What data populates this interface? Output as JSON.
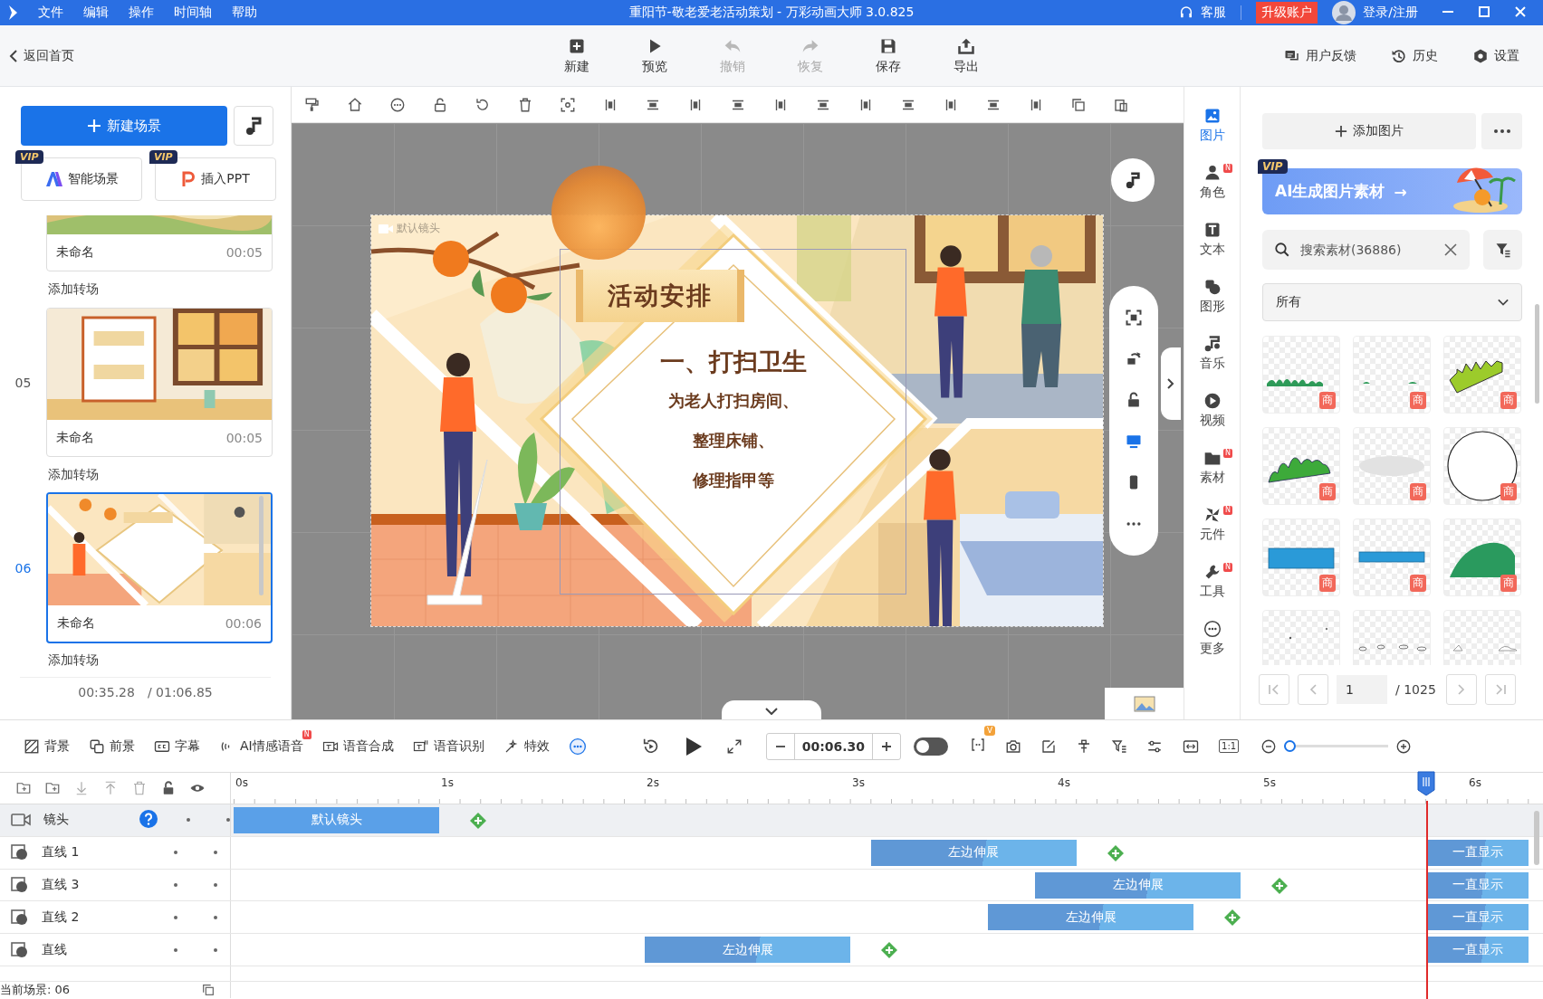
{
  "title_bar": {
    "menu": [
      "文件",
      "编辑",
      "操作",
      "时间轴",
      "帮助"
    ],
    "title": "重阳节-敬老爱老活动策划 - 万彩动画大师 3.0.825",
    "service": "客服",
    "upgrade": "升级账户",
    "login": "登录/注册"
  },
  "toolbar": {
    "back": "返回首页",
    "actions": [
      {
        "label": "新建",
        "kind": "new",
        "disabled": false
      },
      {
        "label": "预览",
        "kind": "preview",
        "disabled": false
      },
      {
        "label": "撤销",
        "kind": "undo",
        "disabled": true
      },
      {
        "label": "恢复",
        "kind": "redo",
        "disabled": true
      },
      {
        "label": "保存",
        "kind": "save",
        "disabled": false
      },
      {
        "label": "导出",
        "kind": "export",
        "disabled": false
      }
    ],
    "right": [
      {
        "label": "用户反馈",
        "kind": "feedback"
      },
      {
        "label": "历史",
        "kind": "history"
      },
      {
        "label": "设置",
        "kind": "settings"
      }
    ]
  },
  "scene_panel": {
    "new_scene": "新建场景",
    "extras": [
      {
        "label": "智能场景",
        "kind": "ai",
        "badge": "VIP"
      },
      {
        "label": "插入PPT",
        "kind": "ppt",
        "badge": "VIP"
      }
    ],
    "scenes": [
      {
        "name": "未命名",
        "duration": "00:05",
        "selected": false,
        "transition": "添加转场"
      },
      {
        "number": "05",
        "name": "未命名",
        "duration": "00:05",
        "selected": false,
        "transition": "添加转场"
      },
      {
        "number": "06",
        "name": "未命名",
        "duration": "00:06",
        "selected": true,
        "transition": "添加转场"
      }
    ],
    "current_time": "00:35.28",
    "total_time": "/ 01:06.85"
  },
  "canvas": {
    "camera_label": "默认镜头",
    "slide": {
      "banner": "活动安排",
      "heading": "一、打扫卫生",
      "lines": [
        "为老人打扫房间、",
        "整理床铺、",
        "修理指甲等"
      ]
    },
    "float_tools": [
      {
        "kind": "focus",
        "selected": false
      },
      {
        "kind": "rotate",
        "selected": false
      },
      {
        "kind": "lock",
        "selected": false
      },
      {
        "kind": "monitor",
        "selected": true
      },
      {
        "kind": "phone",
        "selected": false
      },
      {
        "kind": "more",
        "selected": false
      }
    ]
  },
  "rail": [
    {
      "label": "图片",
      "kind": "image",
      "selected": true
    },
    {
      "label": "角色",
      "kind": "role",
      "selected": false,
      "badge": "N"
    },
    {
      "label": "文本",
      "kind": "text",
      "selected": false
    },
    {
      "label": "图形",
      "kind": "shape",
      "selected": false
    },
    {
      "label": "音乐",
      "kind": "music",
      "selected": false
    },
    {
      "label": "视频",
      "kind": "video",
      "selected": false
    },
    {
      "label": "素材",
      "kind": "material",
      "selected": false,
      "badge": "N"
    },
    {
      "label": "元件",
      "kind": "component",
      "selected": false,
      "badge": "N"
    },
    {
      "label": "工具",
      "kind": "tool",
      "selected": false,
      "badge": "N"
    },
    {
      "label": "更多",
      "kind": "more",
      "selected": false
    }
  ],
  "asset_panel": {
    "add": "添加图片",
    "banner": {
      "badge": "VIP",
      "text": "AI生成图片素材",
      "arrow": "→"
    },
    "search": {
      "placeholder": "搜索素材(36886)"
    },
    "filter": "所有",
    "tiles": [
      {
        "kind": "grass-low",
        "badge": "商"
      },
      {
        "kind": "grass-tiny",
        "badge": "商"
      },
      {
        "kind": "grass-spiky",
        "badge": "商"
      },
      {
        "kind": "hill",
        "badge": "商"
      },
      {
        "kind": "ellipse",
        "badge": "商"
      },
      {
        "kind": "circle",
        "badge": "商"
      },
      {
        "kind": "bar-thick",
        "badge": "商"
      },
      {
        "kind": "bar-thin",
        "badge": "商"
      },
      {
        "kind": "mound",
        "badge": "商"
      },
      {
        "kind": "specks"
      },
      {
        "kind": "pebbles"
      },
      {
        "kind": "clouds"
      }
    ],
    "pagination": {
      "page": "1",
      "total": "/ 1025"
    }
  },
  "edit_bar": {
    "tools": [
      {
        "label": "背景",
        "kind": "background"
      },
      {
        "label": "前景",
        "kind": "foreground"
      },
      {
        "label": "字幕",
        "kind": "subtitle"
      },
      {
        "label": "AI情感语音",
        "kind": "ai-voice",
        "badge": "N"
      },
      {
        "label": "语音合成",
        "kind": "tts"
      },
      {
        "label": "语音识别",
        "kind": "asr"
      },
      {
        "label": "特效",
        "kind": "effects"
      }
    ],
    "time": "00:06.30",
    "toggle": {
      "on": false
    },
    "record_badge": "V",
    "actual_size": "1:1",
    "zoom": {
      "level": 0.05
    }
  },
  "timeline": {
    "ticks": [
      "0s",
      "1s",
      "2s",
      "3s",
      "4s",
      "5s",
      "6s"
    ],
    "tracks": [
      {
        "name": "镜头",
        "kind": "camera",
        "selected": true,
        "clips": [
          "默认镜头"
        ]
      },
      {
        "name": "直线 1",
        "kind": "shape",
        "selected": false,
        "clips": [
          "左边伸展",
          "一直显示"
        ]
      },
      {
        "name": "直线 3",
        "kind": "shape",
        "selected": false,
        "clips": [
          "左边伸展",
          "一直显示"
        ]
      },
      {
        "name": "直线 2",
        "kind": "shape",
        "selected": false,
        "clips": [
          "左边伸展",
          "一直显示"
        ]
      },
      {
        "name": "直线",
        "kind": "shape",
        "selected": false,
        "clips": [
          "左边伸展",
          "一直显示"
        ]
      }
    ],
    "status": "当前场景: 06"
  }
}
